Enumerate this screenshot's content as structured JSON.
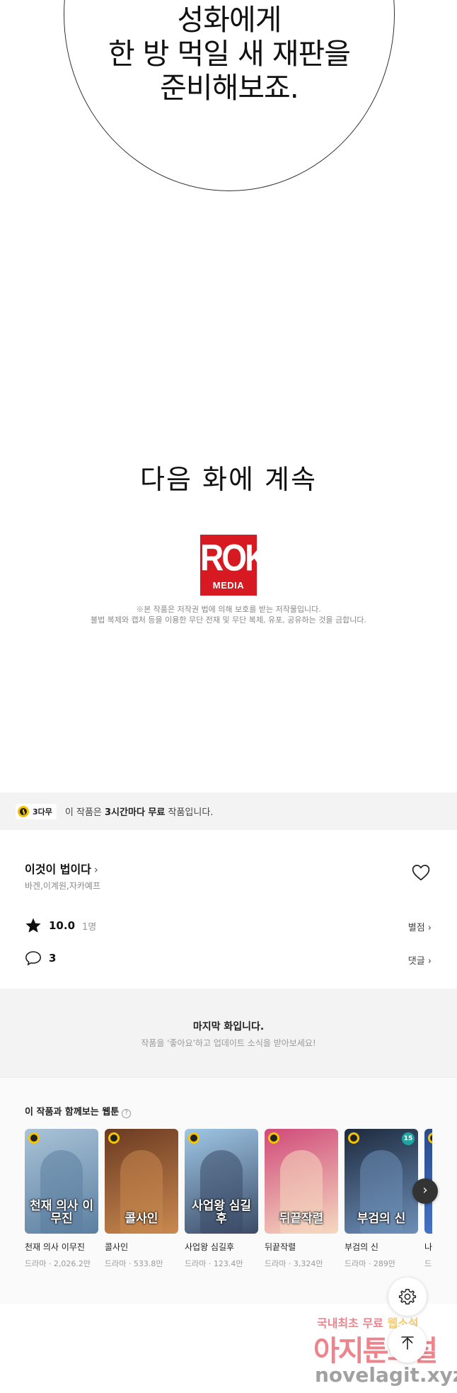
{
  "comic": {
    "bubble_lines": [
      "성화에게",
      "한 방 먹일 새 재판을",
      "준비해보죠."
    ],
    "continue_text": "다음 화에 계속",
    "publisher_logo": {
      "top": "ROK",
      "bottom": "MEDIA"
    },
    "copyright_lines": [
      "※본 작품은 저작권 법에 의해 보호를 받는 저작물입니다.",
      "불법 복제와 캡처 등을 이용한 무단 전재 및 무단 복제, 유포, 공유하는 것을 금합니다."
    ]
  },
  "notice": {
    "badge": "3다무",
    "text_prefix": "이 작품은 ",
    "text_bold": "3시간마다 무료",
    "text_suffix": " 작품입니다."
  },
  "work": {
    "title": "이것이 법이다",
    "title_chevron": "›",
    "authors": "바겐,이계원,자카예프",
    "rating": "10.0",
    "rating_count": "1명",
    "rating_link": "별점 ›",
    "comment_count": "3",
    "comment_link": "댓글 ›"
  },
  "last_episode": {
    "title": "마지막 화입니다.",
    "subtitle": "작품을 '좋아요'하고 업데이트 소식을 받아보세요!"
  },
  "related": {
    "title": "이 작품과 함께보는 웹툰",
    "help": "?",
    "next_icon": "›",
    "cards": [
      {
        "name": "천재 의사 이무진",
        "meta": "드라마 · 2,026.2만",
        "thumb_text": "천재 의사 이무진",
        "clock": true,
        "age": "",
        "bg": "#a9c3d8",
        "fg": "#5c7fa0"
      },
      {
        "name": "콜사인",
        "meta": "드라마 · 533.8만",
        "thumb_text": "콜사인",
        "clock": true,
        "age": "",
        "bg": "#6b3a22",
        "fg": "#c9894f"
      },
      {
        "name": "사업왕 심길후",
        "meta": "드라마 · 123.4만",
        "thumb_text": "사업왕 심길후",
        "clock": true,
        "age": "",
        "bg": "#9fc7e6",
        "fg": "#3b4b66"
      },
      {
        "name": "뒤끝작렬",
        "meta": "드라마 · 3,324만",
        "thumb_text": "뒤끝작렬",
        "clock": true,
        "age": "",
        "bg": "#d04a7a",
        "fg": "#f5d9c0"
      },
      {
        "name": "부검의 신",
        "meta": "드라마 · 289만",
        "thumb_text": "부검의 신",
        "clock": true,
        "age": "15",
        "bg": "#1d2a3e",
        "fg": "#6e8fb8"
      },
      {
        "name": "나",
        "meta": "드",
        "thumb_text": "",
        "clock": true,
        "age": "",
        "bg": "#2a4a8a",
        "fg": "#4c7bd0"
      }
    ]
  },
  "watermark": {
    "line1_a": "국내최초 무료 ",
    "line1_b": "웹소설",
    "line2": "아지툰소설",
    "line3": "novelagit.xyz"
  },
  "icons": {
    "heart": "heart-icon",
    "star": "star-icon",
    "comment": "comment-icon",
    "settings": "gear-icon",
    "to_top": "arrow-up-icon"
  }
}
